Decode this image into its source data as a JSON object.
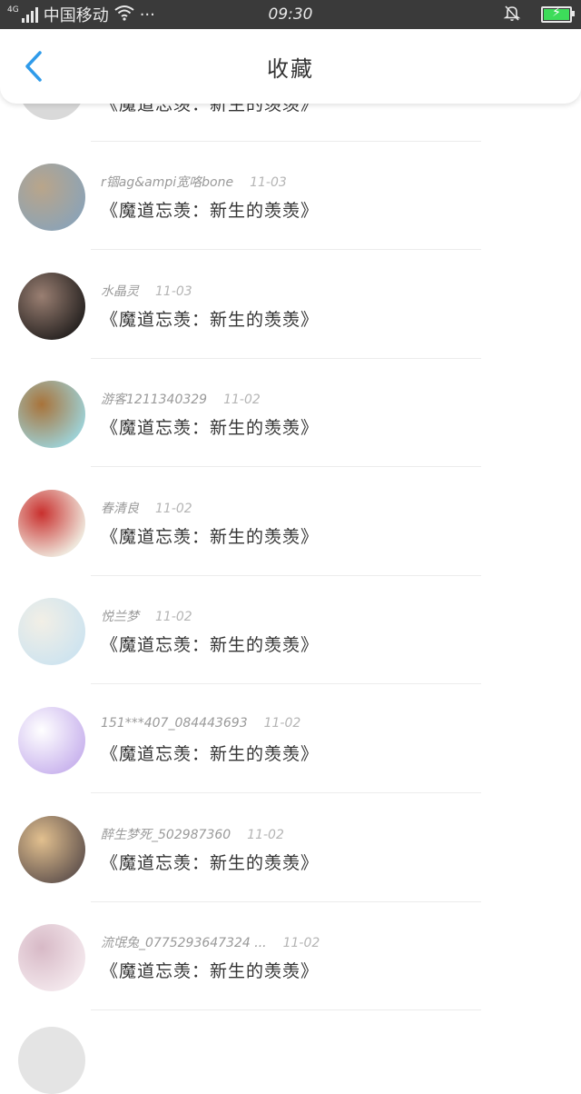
{
  "status_bar": {
    "network_tag": "4G",
    "carrier": "中国移动",
    "extra": "···",
    "time": "09:30"
  },
  "nav": {
    "title": "收藏",
    "back_icon": "chevron-left-icon"
  },
  "partial_top": {
    "title": "《魔道忘羡：新生的羡羡》"
  },
  "items": [
    {
      "user": "r锢ag&ampi宽咯bone",
      "date": "11-03",
      "title": "《魔道忘羡：新生的羡羡》",
      "avatar_colors": [
        "#8ea3b4",
        "#b9a58a"
      ]
    },
    {
      "user": "水晶灵",
      "date": "11-03",
      "title": "《魔道忘羡：新生的羡羡》",
      "avatar_colors": [
        "#2a2523",
        "#9a7f72"
      ]
    },
    {
      "user": "游客1211340329",
      "date": "11-02",
      "title": "《魔道忘羡：新生的羡羡》",
      "avatar_colors": [
        "#9ed0d4",
        "#a8733a"
      ]
    },
    {
      "user": "春清良",
      "date": "11-02",
      "title": "《魔道忘羡：新生的羡羡》",
      "avatar_colors": [
        "#efe7dc",
        "#c9302e"
      ]
    },
    {
      "user": "悦兰梦",
      "date": "11-02",
      "title": "《魔道忘羡：新生的羡羡》",
      "avatar_colors": [
        "#cfe4ef",
        "#f2efe6"
      ]
    },
    {
      "user": "151***407_084443693",
      "date": "11-02",
      "title": "《魔道忘羡：新生的羡羡》",
      "avatar_colors": [
        "#cbb6ee",
        "#ffffff"
      ]
    },
    {
      "user": "醉生梦死_502987360",
      "date": "11-02",
      "title": "《魔道忘羡：新生的羡羡》",
      "avatar_colors": [
        "#6a5a52",
        "#e2c08f"
      ]
    },
    {
      "user": "流氓兔_0775293647324 ...",
      "date": "11-02",
      "title": "《魔道忘羡：新生的羡羡》",
      "avatar_colors": [
        "#f3e7ec",
        "#d7b9c6"
      ]
    }
  ]
}
